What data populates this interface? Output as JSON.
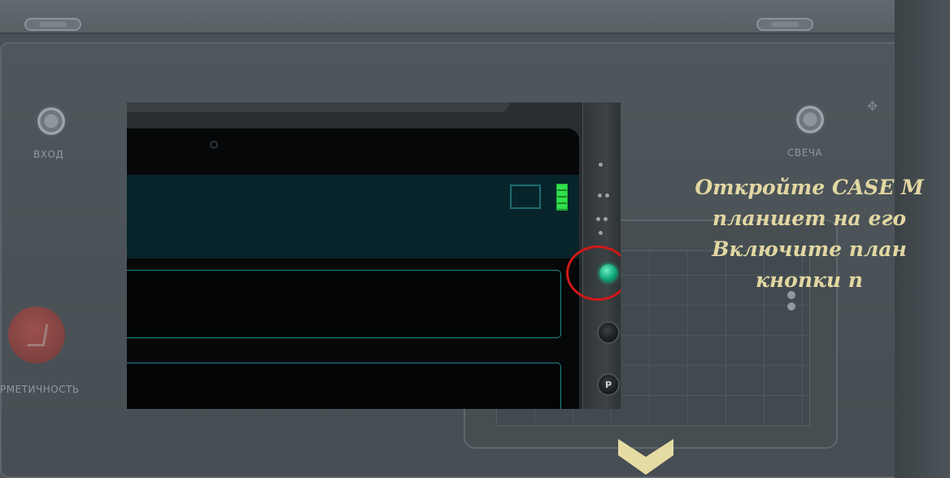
{
  "device": {
    "labels": {
      "input": "ВХОД",
      "spark": "СВЕЧА",
      "hermetic": "РМЕТИЧНОСТЬ"
    }
  },
  "instruction": {
    "lines": [
      "Откройте CASE M",
      "планшет на его",
      "Включите план",
      "кнопки п"
    ]
  },
  "zoom": {
    "side_buttons": {
      "power_label": "",
      "mid_label": "",
      "bottom_label": "P"
    },
    "colors": {
      "led": "#12c38a",
      "highlight_ring": "#d01818",
      "field_border": "#1d8a8f",
      "battery": "#2fe04a"
    }
  },
  "navigation": {
    "scroll_down": "chevron-down-icon"
  }
}
